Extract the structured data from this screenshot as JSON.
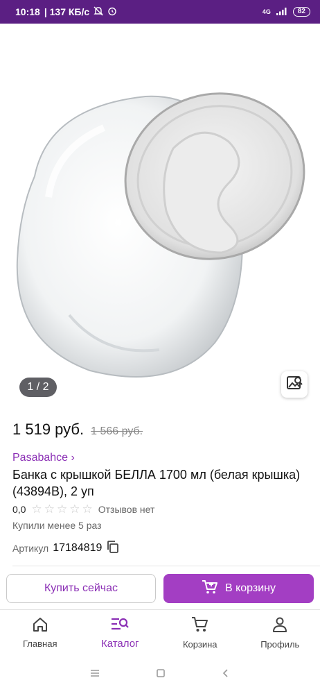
{
  "status_bar": {
    "time": "10:18",
    "speed": "| 137 КБ/с",
    "network": "4G",
    "battery": "82"
  },
  "gallery": {
    "counter": "1 / 2"
  },
  "product": {
    "price": "1 519 руб.",
    "old_price": "1 566 руб.",
    "brand": "Pasabahce ›",
    "title": "Банка с крышкой БЕЛЛА 1700 мл (белая крышка) (43894B), 2 уп",
    "rating_value": "0,0",
    "stars": [
      "☆",
      "☆",
      "☆",
      "☆",
      "☆"
    ],
    "reviews": "Отзывов нет",
    "bought": "Купили менее 5 раз",
    "article_label": "Артикул",
    "article_value": "17184819"
  },
  "actions": {
    "buy_now": "Купить сейчас",
    "add_to_cart": "В корзину"
  },
  "bottom_nav": {
    "items": [
      {
        "label": "Главная",
        "icon": "home-icon"
      },
      {
        "label": "Каталог",
        "icon": "catalog-icon"
      },
      {
        "label": "Корзина",
        "icon": "cart-icon"
      },
      {
        "label": "Профиль",
        "icon": "profile-icon"
      }
    ],
    "active_index": 1
  },
  "colors": {
    "status_bar": "#5b1f83",
    "accent": "#a33ec3",
    "brand_text": "#8b2fb5"
  }
}
